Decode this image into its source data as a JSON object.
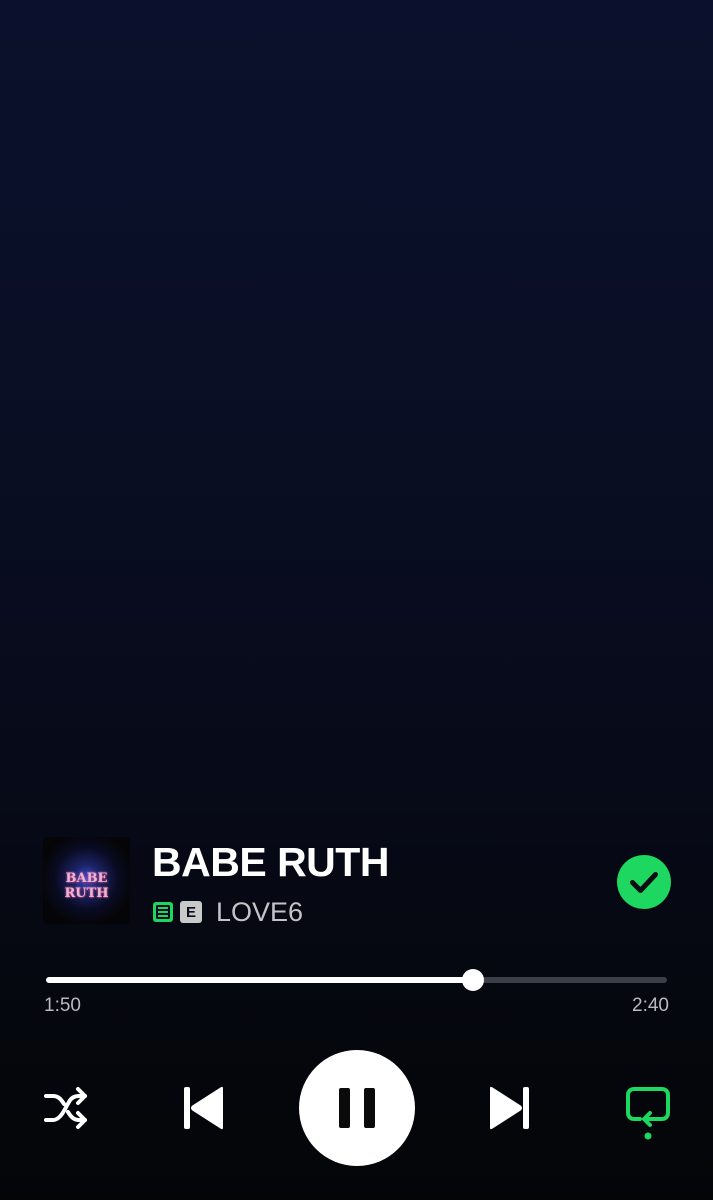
{
  "track": {
    "title": "BABE RUTH",
    "artist": "LOVE6",
    "album_art_text": "BABE RUTH",
    "explicit_badge": "E",
    "lyrics_available": true,
    "saved": true
  },
  "playback": {
    "elapsed": "1:50",
    "total": "2:40",
    "progress_fraction": 0.6875,
    "state": "playing",
    "shuffle": false,
    "repeat": true
  },
  "icons": {
    "lyrics": "lyrics-icon",
    "saved": "check-circle-icon",
    "shuffle": "shuffle-icon",
    "previous": "skip-previous-icon",
    "pause": "pause-icon",
    "next": "skip-next-icon",
    "repeat": "repeat-icon"
  },
  "colors": {
    "accent": "#1ed760",
    "background_top": "#0b102c",
    "background_bottom": "#040507"
  }
}
